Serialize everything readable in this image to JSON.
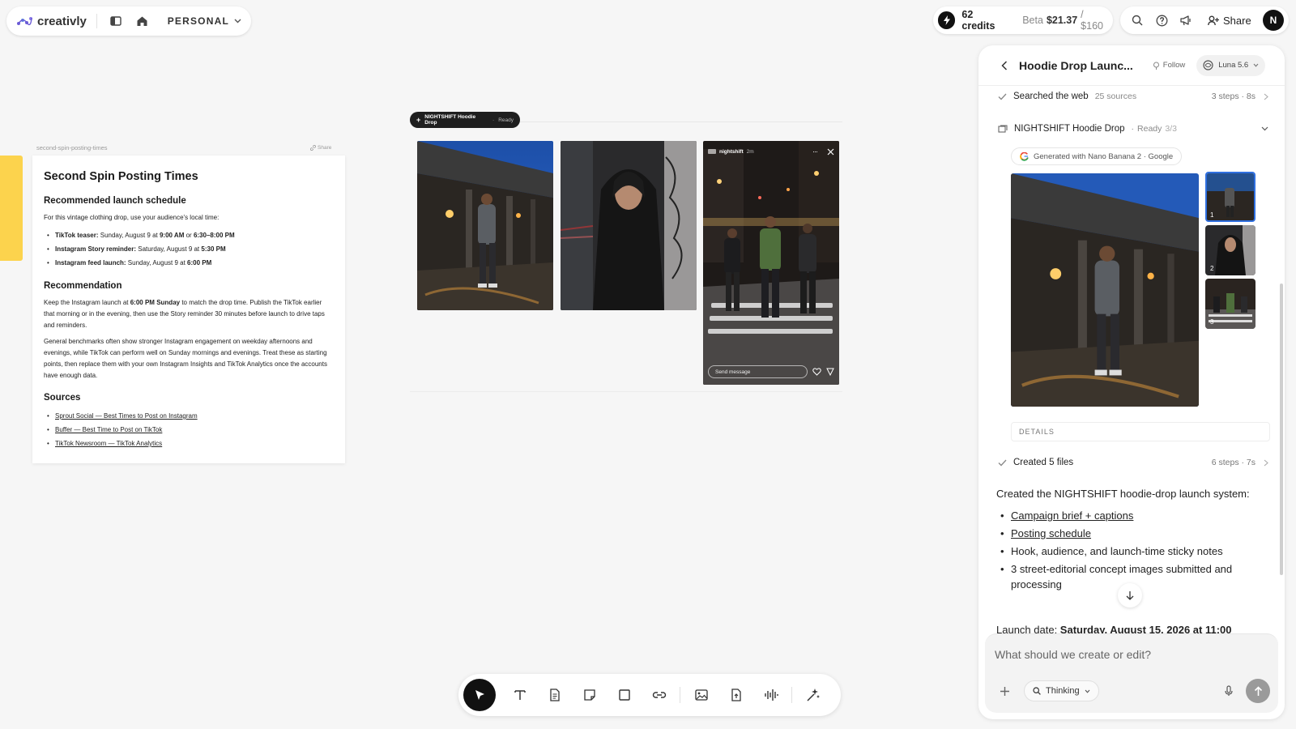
{
  "app": {
    "brand": "creativly",
    "workspace": "PERSONAL"
  },
  "topbar": {
    "credits": "62 credits",
    "beta_label": "Beta",
    "spend": "$21.37",
    "budget": "/ $160",
    "share": "Share",
    "avatar": "N"
  },
  "doc": {
    "filename": "second-spin-posting-times",
    "share": "Share",
    "title": "Second Spin Posting Times",
    "h_schedule": "Recommended launch schedule",
    "intro": "For this vintage clothing drop, use your audience's local time:",
    "schedule": [
      {
        "label": "TikTok teaser:",
        "text": " Sunday, August 9 at ",
        "time": "9:00 AM",
        "text2": " or ",
        "time2": "6:30–8:00 PM"
      },
      {
        "label": "Instagram Story reminder:",
        "text": " Saturday, August 9 at ",
        "time": "5:30 PM",
        "text2": "",
        "time2": ""
      },
      {
        "label": "Instagram feed launch:",
        "text": " Sunday, August 9 at ",
        "time": "6:00 PM",
        "text2": "",
        "time2": ""
      }
    ],
    "h_recommendation": "Recommendation",
    "rec_a": "Keep the Instagram launch at ",
    "rec_b": "6:00 PM Sunday",
    "rec_c": " to match the drop time. Publish the TikTok earlier that morning or in the evening, then use the Story reminder 30 minutes before launch to drive taps and reminders.",
    "rec_p2": "General benchmarks often show stronger Instagram engagement on weekday afternoons and evenings, while TikTok can perform well on Sunday mornings and evenings. Treat these as starting points, then replace them with your own Instagram Insights and TikTok Analytics once the accounts have enough data.",
    "h_sources": "Sources",
    "sources": [
      "Sprout Social — Best Times to Post on Instagram",
      "Buffer — Best Time to Post on TikTok",
      "TikTok Newsroom — TikTok Analytics"
    ]
  },
  "canvas": {
    "group_name": "NIGHTSHIFT Hoodie Drop",
    "group_status": "Ready",
    "story": {
      "account": "nightshift",
      "age": "2m",
      "send_placeholder": "Send message"
    }
  },
  "panel": {
    "title": "Hoodie Drop Launc...",
    "follow": "Follow",
    "model": "Luna 5.6",
    "search_step": {
      "label": "Searched the web",
      "sources": "25 sources",
      "steps": "3 steps · 8s"
    },
    "asset": {
      "name": "NIGHTSHIFT Hoodie Drop",
      "status": "Ready",
      "count": "3/3",
      "generated_with": "Generated with Nano Banana 2 · Google"
    },
    "thumbs": [
      "1",
      "2",
      "3"
    ],
    "details": "DETAILS",
    "files_step": {
      "label": "Created 5 files",
      "steps": "6 steps · 7s"
    },
    "summary_intro": "Created the NIGHTSHIFT hoodie-drop launch system:",
    "summary_items": [
      {
        "text": "Campaign brief + captions",
        "link": true
      },
      {
        "text": "Posting schedule",
        "link": true
      },
      {
        "text": "Hook, audience, and launch-time sticky notes",
        "link": false
      },
      {
        "text": "3 street-editorial concept images submitted and processing",
        "link": false
      }
    ],
    "launch_label": "Launch date: ",
    "launch_value": "Saturday, August 15, 2026 at 11:00",
    "composer_placeholder": "What should we create or edit?",
    "mode": "Thinking"
  },
  "colors": {
    "accent_dark": "#111111",
    "sticky_yellow": "#fcd34d",
    "brand_purple": "#6b5bd6"
  }
}
